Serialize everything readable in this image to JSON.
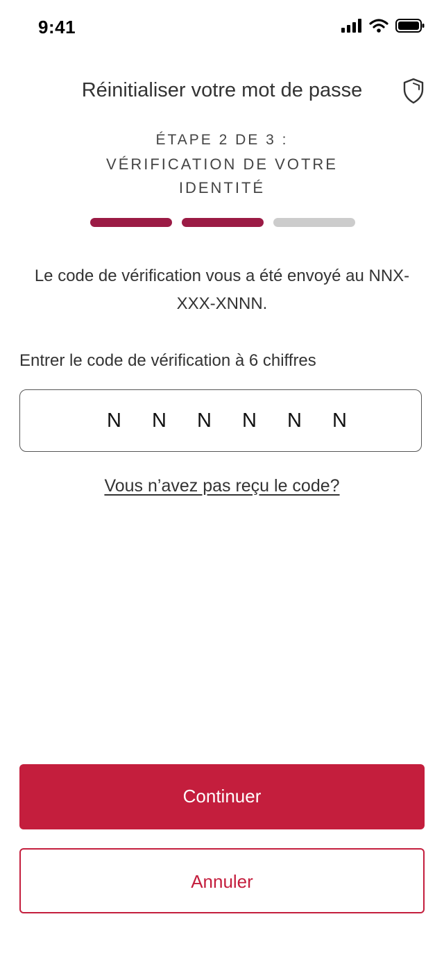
{
  "status_bar": {
    "time": "9:41",
    "icons": [
      "signal-icon",
      "wifi-icon",
      "battery-icon"
    ]
  },
  "header": {
    "title": "Réinitialiser votre mot de passe",
    "icon": "shield-icon"
  },
  "step": {
    "label": "ÉTAPE 2 DE 3 :",
    "title": "VÉRIFICATION DE VOTRE IDENTITÉ",
    "current": 2,
    "total": 3
  },
  "info": {
    "message": "Le code de vérification vous a été envoyé au NNX-XXX-XNNN."
  },
  "code_input": {
    "label": "Entrer le code de vérification à 6 chiffres",
    "digits": [
      "N",
      "N",
      "N",
      "N",
      "N",
      "N"
    ]
  },
  "resend": {
    "label": "Vous n’avez pas reçu le code?"
  },
  "buttons": {
    "continue_label": "Continuer",
    "cancel_label": "Annuler"
  },
  "colors": {
    "progress_done": "#9b1b45",
    "progress_todo": "#cccccc",
    "primary": "#c41e3d"
  }
}
